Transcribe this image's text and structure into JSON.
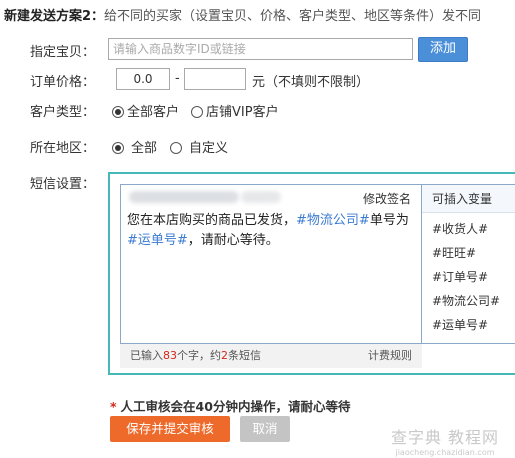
{
  "section": {
    "title": "新建发送方案2：",
    "description": "给不同的买家（设置宝贝、价格、客户类型、地区等条件）发不同"
  },
  "form": {
    "product": {
      "label": "指定宝贝：",
      "placeholder": "请输入商品数字ID或链接",
      "add_button": "添加"
    },
    "price": {
      "label": "订单价格：",
      "min_value": "0.0",
      "max_value": "",
      "separator": "-",
      "unit_note": "元（不填则不限制）"
    },
    "customer_type": {
      "label": "客户类型：",
      "options": [
        "全部客户",
        "店铺VIP客户"
      ],
      "selected": "全部客户"
    },
    "region": {
      "label": "所在地区：",
      "options": [
        "全部",
        "自定义"
      ],
      "selected": "全部"
    },
    "sms": {
      "label": "短信设置：",
      "edit_signature": "修改签名",
      "message_parts": [
        {
          "text": "您在本店购买的商品已发货，",
          "var": false
        },
        {
          "text": "#物流公司#",
          "var": true
        },
        {
          "text": "单号为",
          "var": false
        },
        {
          "text": "#运单号#",
          "var": true
        },
        {
          "text": "，请耐心等待。",
          "var": false
        }
      ],
      "variables_title": "可插入变量",
      "variables": [
        "#收货人#",
        "#旺旺#",
        "#订单号#",
        "#物流公司#",
        "#运单号#"
      ],
      "status": {
        "prefix": "已输入",
        "char_count": "83",
        "middle": "个字，约",
        "sms_count": "2",
        "suffix": "条短信"
      },
      "billing_rules": "计费规则"
    }
  },
  "notice": {
    "star": "*",
    "text": "人工审核会在40分钟内操作，请耐心等待"
  },
  "actions": {
    "submit": "保存并提交审核",
    "cancel": "取消"
  },
  "watermark": {
    "line1": "查字典 教程网",
    "line2": "jiaocheng.chazidian.com"
  },
  "colors": {
    "add_button": "#4a8fd8",
    "submit_button": "#ee6a2a",
    "cancel_button": "#c4c4c4",
    "sms_border": "#47b8b8",
    "variable_text": "#3b7bd0",
    "count_highlight": "#d4281b"
  }
}
